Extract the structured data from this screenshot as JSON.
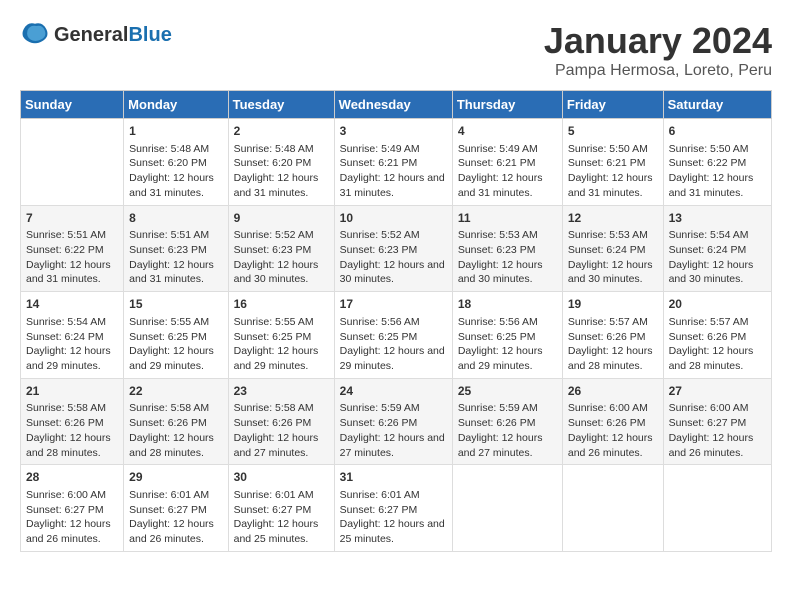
{
  "header": {
    "logo_general": "General",
    "logo_blue": "Blue",
    "month_title": "January 2024",
    "location": "Pampa Hermosa, Loreto, Peru"
  },
  "days_of_week": [
    "Sunday",
    "Monday",
    "Tuesday",
    "Wednesday",
    "Thursday",
    "Friday",
    "Saturday"
  ],
  "weeks": [
    [
      {
        "day": "",
        "sunrise": "",
        "sunset": "",
        "daylight": ""
      },
      {
        "day": "1",
        "sunrise": "Sunrise: 5:48 AM",
        "sunset": "Sunset: 6:20 PM",
        "daylight": "Daylight: 12 hours and 31 minutes."
      },
      {
        "day": "2",
        "sunrise": "Sunrise: 5:48 AM",
        "sunset": "Sunset: 6:20 PM",
        "daylight": "Daylight: 12 hours and 31 minutes."
      },
      {
        "day": "3",
        "sunrise": "Sunrise: 5:49 AM",
        "sunset": "Sunset: 6:21 PM",
        "daylight": "Daylight: 12 hours and 31 minutes."
      },
      {
        "day": "4",
        "sunrise": "Sunrise: 5:49 AM",
        "sunset": "Sunset: 6:21 PM",
        "daylight": "Daylight: 12 hours and 31 minutes."
      },
      {
        "day": "5",
        "sunrise": "Sunrise: 5:50 AM",
        "sunset": "Sunset: 6:21 PM",
        "daylight": "Daylight: 12 hours and 31 minutes."
      },
      {
        "day": "6",
        "sunrise": "Sunrise: 5:50 AM",
        "sunset": "Sunset: 6:22 PM",
        "daylight": "Daylight: 12 hours and 31 minutes."
      }
    ],
    [
      {
        "day": "7",
        "sunrise": "Sunrise: 5:51 AM",
        "sunset": "Sunset: 6:22 PM",
        "daylight": "Daylight: 12 hours and 31 minutes."
      },
      {
        "day": "8",
        "sunrise": "Sunrise: 5:51 AM",
        "sunset": "Sunset: 6:23 PM",
        "daylight": "Daylight: 12 hours and 31 minutes."
      },
      {
        "day": "9",
        "sunrise": "Sunrise: 5:52 AM",
        "sunset": "Sunset: 6:23 PM",
        "daylight": "Daylight: 12 hours and 30 minutes."
      },
      {
        "day": "10",
        "sunrise": "Sunrise: 5:52 AM",
        "sunset": "Sunset: 6:23 PM",
        "daylight": "Daylight: 12 hours and 30 minutes."
      },
      {
        "day": "11",
        "sunrise": "Sunrise: 5:53 AM",
        "sunset": "Sunset: 6:23 PM",
        "daylight": "Daylight: 12 hours and 30 minutes."
      },
      {
        "day": "12",
        "sunrise": "Sunrise: 5:53 AM",
        "sunset": "Sunset: 6:24 PM",
        "daylight": "Daylight: 12 hours and 30 minutes."
      },
      {
        "day": "13",
        "sunrise": "Sunrise: 5:54 AM",
        "sunset": "Sunset: 6:24 PM",
        "daylight": "Daylight: 12 hours and 30 minutes."
      }
    ],
    [
      {
        "day": "14",
        "sunrise": "Sunrise: 5:54 AM",
        "sunset": "Sunset: 6:24 PM",
        "daylight": "Daylight: 12 hours and 29 minutes."
      },
      {
        "day": "15",
        "sunrise": "Sunrise: 5:55 AM",
        "sunset": "Sunset: 6:25 PM",
        "daylight": "Daylight: 12 hours and 29 minutes."
      },
      {
        "day": "16",
        "sunrise": "Sunrise: 5:55 AM",
        "sunset": "Sunset: 6:25 PM",
        "daylight": "Daylight: 12 hours and 29 minutes."
      },
      {
        "day": "17",
        "sunrise": "Sunrise: 5:56 AM",
        "sunset": "Sunset: 6:25 PM",
        "daylight": "Daylight: 12 hours and 29 minutes."
      },
      {
        "day": "18",
        "sunrise": "Sunrise: 5:56 AM",
        "sunset": "Sunset: 6:25 PM",
        "daylight": "Daylight: 12 hours and 29 minutes."
      },
      {
        "day": "19",
        "sunrise": "Sunrise: 5:57 AM",
        "sunset": "Sunset: 6:26 PM",
        "daylight": "Daylight: 12 hours and 28 minutes."
      },
      {
        "day": "20",
        "sunrise": "Sunrise: 5:57 AM",
        "sunset": "Sunset: 6:26 PM",
        "daylight": "Daylight: 12 hours and 28 minutes."
      }
    ],
    [
      {
        "day": "21",
        "sunrise": "Sunrise: 5:58 AM",
        "sunset": "Sunset: 6:26 PM",
        "daylight": "Daylight: 12 hours and 28 minutes."
      },
      {
        "day": "22",
        "sunrise": "Sunrise: 5:58 AM",
        "sunset": "Sunset: 6:26 PM",
        "daylight": "Daylight: 12 hours and 28 minutes."
      },
      {
        "day": "23",
        "sunrise": "Sunrise: 5:58 AM",
        "sunset": "Sunset: 6:26 PM",
        "daylight": "Daylight: 12 hours and 27 minutes."
      },
      {
        "day": "24",
        "sunrise": "Sunrise: 5:59 AM",
        "sunset": "Sunset: 6:26 PM",
        "daylight": "Daylight: 12 hours and 27 minutes."
      },
      {
        "day": "25",
        "sunrise": "Sunrise: 5:59 AM",
        "sunset": "Sunset: 6:26 PM",
        "daylight": "Daylight: 12 hours and 27 minutes."
      },
      {
        "day": "26",
        "sunrise": "Sunrise: 6:00 AM",
        "sunset": "Sunset: 6:26 PM",
        "daylight": "Daylight: 12 hours and 26 minutes."
      },
      {
        "day": "27",
        "sunrise": "Sunrise: 6:00 AM",
        "sunset": "Sunset: 6:27 PM",
        "daylight": "Daylight: 12 hours and 26 minutes."
      }
    ],
    [
      {
        "day": "28",
        "sunrise": "Sunrise: 6:00 AM",
        "sunset": "Sunset: 6:27 PM",
        "daylight": "Daylight: 12 hours and 26 minutes."
      },
      {
        "day": "29",
        "sunrise": "Sunrise: 6:01 AM",
        "sunset": "Sunset: 6:27 PM",
        "daylight": "Daylight: 12 hours and 26 minutes."
      },
      {
        "day": "30",
        "sunrise": "Sunrise: 6:01 AM",
        "sunset": "Sunset: 6:27 PM",
        "daylight": "Daylight: 12 hours and 25 minutes."
      },
      {
        "day": "31",
        "sunrise": "Sunrise: 6:01 AM",
        "sunset": "Sunset: 6:27 PM",
        "daylight": "Daylight: 12 hours and 25 minutes."
      },
      {
        "day": "",
        "sunrise": "",
        "sunset": "",
        "daylight": ""
      },
      {
        "day": "",
        "sunrise": "",
        "sunset": "",
        "daylight": ""
      },
      {
        "day": "",
        "sunrise": "",
        "sunset": "",
        "daylight": ""
      }
    ]
  ]
}
